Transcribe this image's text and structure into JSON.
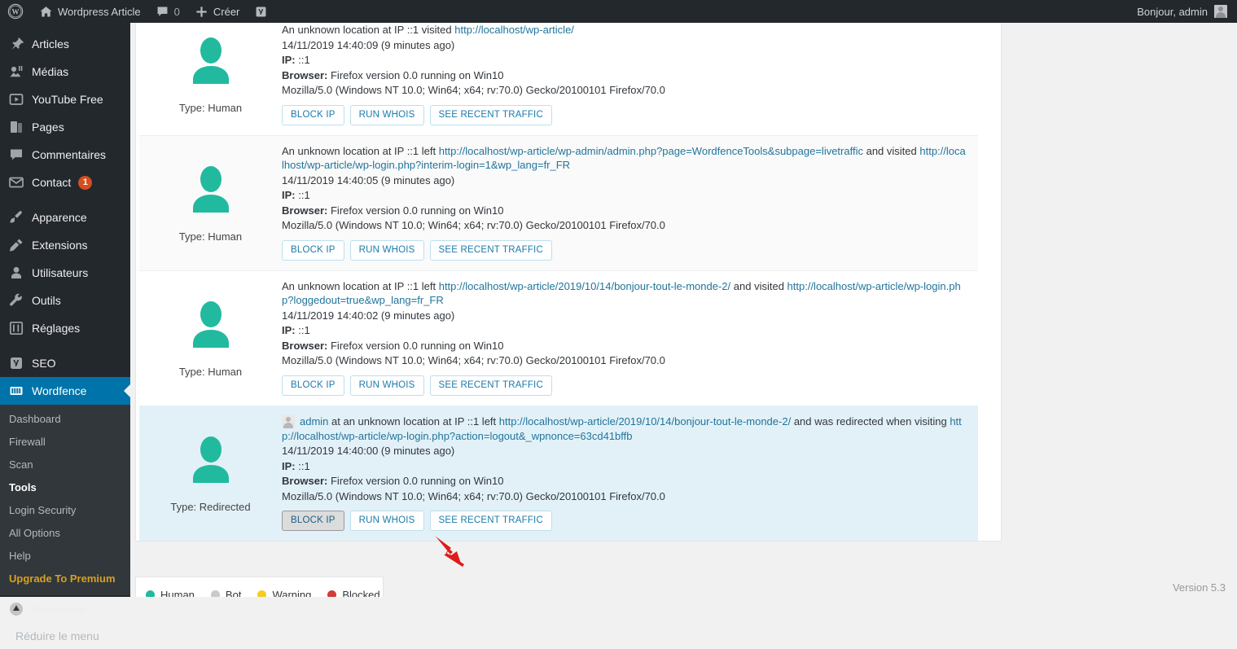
{
  "adminbar": {
    "logo_icon": "wordpress-logo-icon",
    "site_name": "Wordpress Article",
    "home_icon": "home-icon",
    "comments_icon": "comment-bubble-icon",
    "comments_count": "0",
    "new_icon": "plus-icon",
    "new_label": "Créer",
    "seo_icon": "yoast-seo-icon",
    "greeting": "Bonjour, admin",
    "avatar_icon": "user-avatar-icon"
  },
  "sidebar": {
    "items": [
      {
        "label": "Articles",
        "icon": "pin-icon"
      },
      {
        "label": "Médias",
        "icon": "media-icon"
      },
      {
        "label": "YouTube Free",
        "icon": "video-play-icon"
      },
      {
        "label": "Pages",
        "icon": "pages-icon"
      },
      {
        "label": "Commentaires",
        "icon": "comment-bubble-icon"
      },
      {
        "label": "Contact",
        "icon": "envelope-icon",
        "badge": "1"
      },
      {
        "label": "Apparence",
        "icon": "paintbrush-icon"
      },
      {
        "label": "Extensions",
        "icon": "plug-icon"
      },
      {
        "label": "Utilisateurs",
        "icon": "user-icon"
      },
      {
        "label": "Outils",
        "icon": "wrench-icon"
      },
      {
        "label": "Réglages",
        "icon": "sliders-icon"
      },
      {
        "label": "SEO",
        "icon": "yoast-seo-icon"
      },
      {
        "label": "Wordfence",
        "icon": "wordfence-icon",
        "current": true
      }
    ],
    "wordfence_submenu": [
      {
        "label": "Dashboard"
      },
      {
        "label": "Firewall"
      },
      {
        "label": "Scan"
      },
      {
        "label": "Tools",
        "current": true
      },
      {
        "label": "Login Security"
      },
      {
        "label": "All Options"
      },
      {
        "label": "Help"
      },
      {
        "label": "Upgrade To Premium",
        "premium": true
      }
    ],
    "after_items": [
      {
        "label": "MetaSlider",
        "icon": "metaslider-icon"
      }
    ],
    "collapse": {
      "label": "Réduire le menu",
      "icon": "collapse-arrow-icon"
    }
  },
  "live_traffic": {
    "buttons": {
      "block_ip": "BLOCK IP",
      "run_whois": "RUN WHOIS",
      "see_recent_traffic": "SEE RECENT TRAFFIC"
    },
    "labels": {
      "ip_prefix": "IP:",
      "browser_prefix": "Browser:"
    },
    "rows": [
      {
        "type_label": "Type: Human",
        "avatar_icon": "human-visitor-icon",
        "summary_pre": "An unknown location at IP ::1 visited ",
        "link1": "http://localhost/wp-article/",
        "summary_mid": "",
        "link2": "",
        "summary_post": "",
        "timestamp": "14/11/2019 14:40:09 (9 minutes ago)",
        "ip": "::1",
        "browser": "Firefox version 0.0 running on Win10",
        "user_agent": "Mozilla/5.0 (Windows NT 10.0; Win64; x64; rv:70.0) Gecko/20100101 Firefox/70.0"
      },
      {
        "type_label": "Type: Human",
        "avatar_icon": "human-visitor-icon",
        "summary_pre": "An unknown location at IP ::1 left ",
        "link1": "http://localhost/wp-article/wp-admin/admin.php?page=WordfenceTools&subpage=livetraffic",
        "summary_mid": " and visited ",
        "link2": "http://localhost/wp-article/wp-login.php?interim-login=1&wp_lang=fr_FR",
        "summary_post": "",
        "timestamp": "14/11/2019 14:40:05 (9 minutes ago)",
        "ip": "::1",
        "browser": "Firefox version 0.0 running on Win10",
        "user_agent": "Mozilla/5.0 (Windows NT 10.0; Win64; x64; rv:70.0) Gecko/20100101 Firefox/70.0"
      },
      {
        "type_label": "Type: Human",
        "avatar_icon": "human-visitor-icon",
        "summary_pre": "An unknown location at IP ::1 left ",
        "link1": "http://localhost/wp-article/2019/10/14/bonjour-tout-le-monde-2/",
        "summary_mid": " and visited ",
        "link2": "http://localhost/wp-article/wp-login.php?loggedout=true&wp_lang=fr_FR",
        "summary_post": "",
        "timestamp": "14/11/2019 14:40:02 (9 minutes ago)",
        "ip": "::1",
        "browser": "Firefox version 0.0 running on Win10",
        "user_agent": "Mozilla/5.0 (Windows NT 10.0; Win64; x64; rv:70.0) Gecko/20100101 Firefox/70.0"
      },
      {
        "type_label": "Type: Redirected",
        "avatar_icon": "human-visitor-icon",
        "username": "admin",
        "summary_pre": " at an unknown location at IP ::1 left ",
        "link1": "http://localhost/wp-article/2019/10/14/bonjour-tout-le-monde-2/",
        "summary_mid": " and was redirected when visiting ",
        "link2": "http://localhost/wp-article/wp-login.php?action=logout&_wpnonce=63cd41bffb",
        "summary_post": "",
        "timestamp": "14/11/2019 14:40:00 (9 minutes ago)",
        "ip": "::1",
        "browser": "Firefox version 0.0 running on Win10",
        "user_agent": "Mozilla/5.0 (Windows NT 10.0; Win64; x64; rv:70.0) Gecko/20100101 Firefox/70.0",
        "highlighted": true,
        "block_pressed": true
      }
    ]
  },
  "legend": {
    "items": [
      {
        "label": "Human",
        "color": "#21ba9f"
      },
      {
        "label": "Bot",
        "color": "#c7c9cb"
      },
      {
        "label": "Warning",
        "color": "#f5cc20"
      },
      {
        "label": "Blocked",
        "color": "#d23b3b"
      }
    ]
  },
  "footer": {
    "version": "Version 5.3"
  },
  "colors": {
    "admin_dark": "#23282d",
    "admin_submenu": "#32373c",
    "accent_blue": "#0073aa",
    "link_blue": "#21759b",
    "human_green": "#21ba9f",
    "highlight_row": "#e2f1f8",
    "premium_gold": "#d7a01e",
    "badge_orange": "#d54e21",
    "arrow_red": "#e01b1b"
  }
}
